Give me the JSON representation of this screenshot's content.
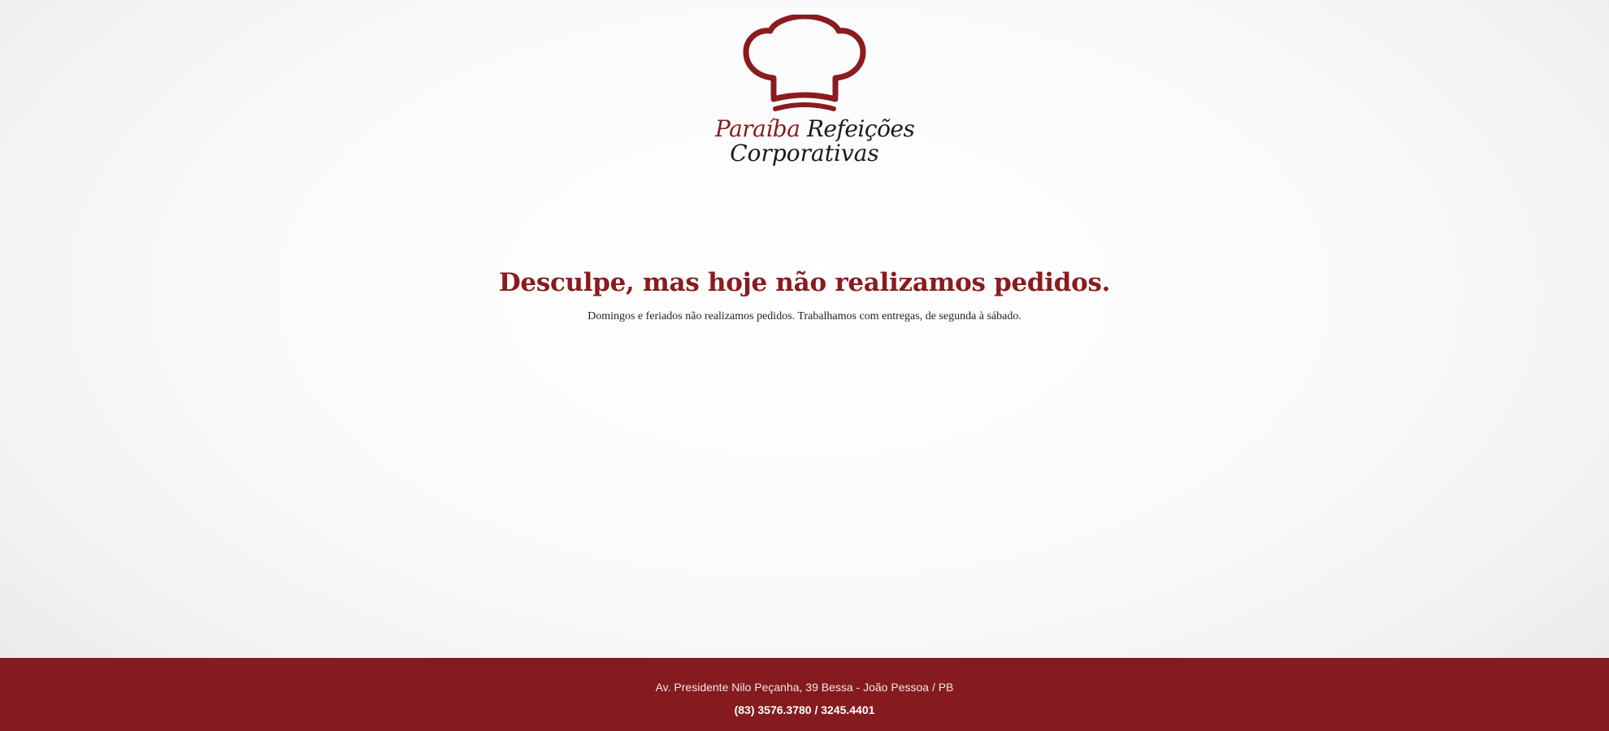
{
  "brand": {
    "name_part1": "Paraíba",
    "name_part2": "Refeições",
    "name_part3": "Corporativas",
    "logo_icon": "chef-hat-icon",
    "accent_color": "#8a1b1f"
  },
  "message": {
    "title": "Desculpe, mas hoje não realizamos pedidos.",
    "subtitle": "Domingos e feriados não realizamos pedidos. Trabalhamos com entregas, de segunda à sábado."
  },
  "footer": {
    "address": "Av. Presidente Nilo Peçanha, 39 Bessa - João Pessoa / PB",
    "phone": "(83) 3576.3780 / 3245.4401",
    "background_color": "#851b1f"
  }
}
